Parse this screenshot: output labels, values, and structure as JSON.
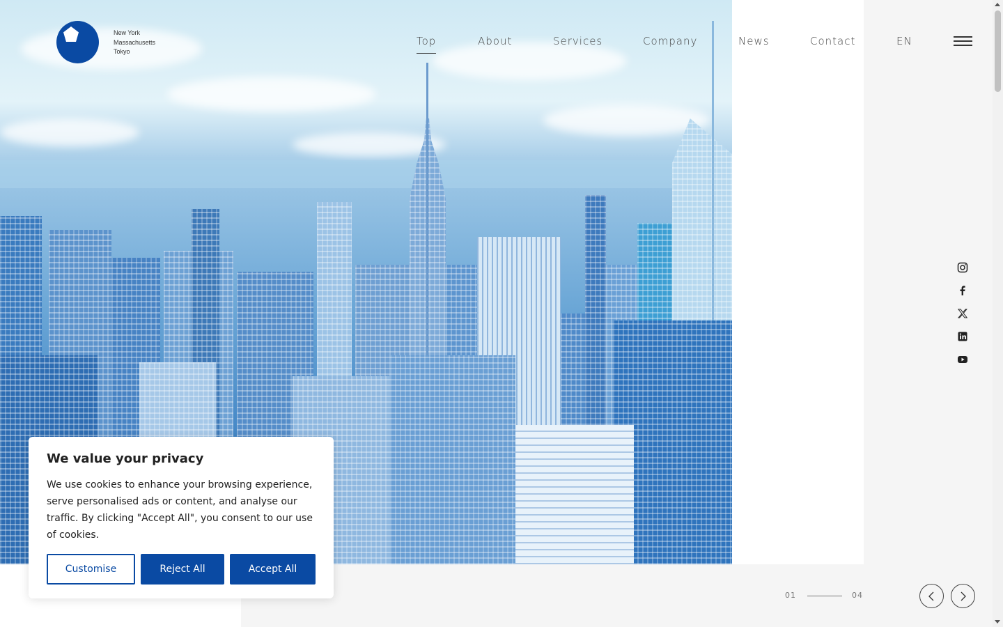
{
  "brand": {
    "logo_icon": "pentagon-logo-icon",
    "cities": [
      "New York",
      "Massachusetts",
      "Tokyo"
    ],
    "color": "#0a4aa3"
  },
  "nav": {
    "items": [
      {
        "label": "Top",
        "active": true
      },
      {
        "label": "About"
      },
      {
        "label": "Services"
      },
      {
        "label": "Company"
      },
      {
        "label": "News"
      },
      {
        "label": "Contact"
      },
      {
        "label": "EN"
      }
    ],
    "menu_icon": "hamburger-icon"
  },
  "hero": {
    "image_icon": "city-skyline-photo"
  },
  "social": [
    "instagram-icon",
    "facebook-icon",
    "x-icon",
    "linkedin-icon",
    "youtube-icon"
  ],
  "slider": {
    "current": "01",
    "total": "04",
    "prev_icon": "chevron-left-icon",
    "next_icon": "chevron-right-icon"
  },
  "cookie": {
    "title": "We value your privacy",
    "body": "We use cookies to enhance your browsing experience, serve personalised ads or content, and analyse our traffic. By clicking \"Accept All\", you consent to our use of cookies.",
    "customise": "Customise",
    "reject": "Reject All",
    "accept": "Accept All"
  }
}
